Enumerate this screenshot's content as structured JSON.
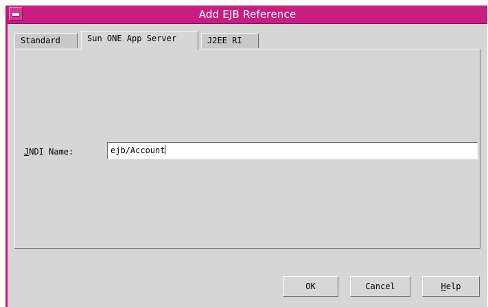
{
  "window": {
    "title": "Add EJB Reference"
  },
  "tabs": [
    {
      "label": "Standard",
      "active": false
    },
    {
      "label": "Sun ONE App Server",
      "active": true
    },
    {
      "label": "J2EE RI",
      "active": false
    }
  ],
  "form": {
    "jndi_label_mnemonic": "J",
    "jndi_label_rest": "NDI Name:",
    "jndi_value": "ejb/Account"
  },
  "buttons": {
    "ok_label": "OK",
    "cancel_label": "Cancel",
    "help_mnemonic": "H",
    "help_rest": "elp"
  },
  "icons": {
    "window_menu": "window-menu-icon"
  },
  "colors": {
    "titlebar": "#c81e82",
    "dialog_background": "#d6d6d6"
  }
}
